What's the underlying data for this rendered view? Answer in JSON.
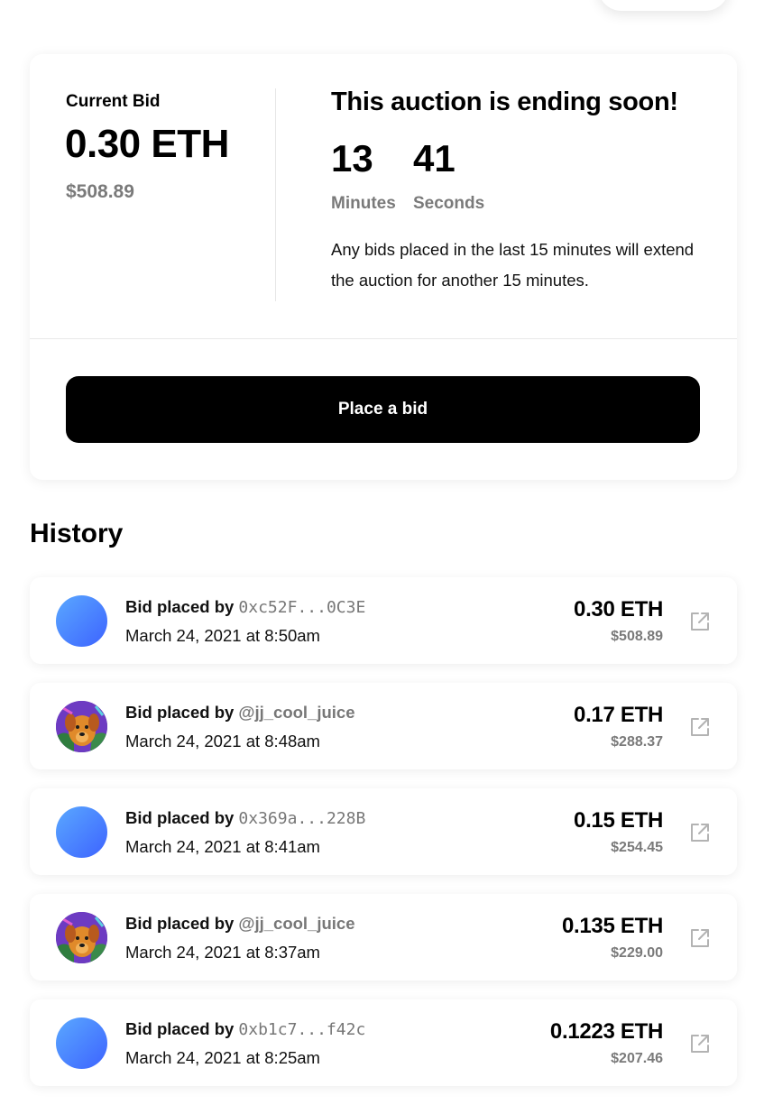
{
  "auction": {
    "current_bid_label": "Current Bid",
    "current_bid_eth": "0.30 ETH",
    "current_bid_usd": "$508.89",
    "ending_title": "This auction is ending soon!",
    "countdown": {
      "minutes_value": "13",
      "minutes_label": "Minutes",
      "seconds_value": "41",
      "seconds_label": "Seconds"
    },
    "notice": "Any bids placed in the last 15 minutes will extend the auction for another 15 minutes.",
    "place_bid_label": "Place a bid"
  },
  "history": {
    "title": "History",
    "bids": [
      {
        "prefix": "Bid placed by",
        "bidder": "0xc52F...0C3E",
        "bidder_type": "address",
        "avatar": "gradient-avatar",
        "date": "March 24, 2021 at 8:50am",
        "eth": "0.30 ETH",
        "usd": "$508.89",
        "icon": "external-link-icon"
      },
      {
        "prefix": "Bid placed by",
        "bidder": "@jj_cool_juice",
        "bidder_type": "handle",
        "avatar": "dog-avatar",
        "date": "March 24, 2021 at 8:48am",
        "eth": "0.17 ETH",
        "usd": "$288.37",
        "icon": "external-link-icon"
      },
      {
        "prefix": "Bid placed by",
        "bidder": "0x369a...228B",
        "bidder_type": "address",
        "avatar": "gradient-avatar",
        "date": "March 24, 2021 at 8:41am",
        "eth": "0.15 ETH",
        "usd": "$254.45",
        "icon": "external-link-icon"
      },
      {
        "prefix": "Bid placed by",
        "bidder": "@jj_cool_juice",
        "bidder_type": "handle",
        "avatar": "dog-avatar",
        "date": "March 24, 2021 at 8:37am",
        "eth": "0.135 ETH",
        "usd": "$229.00",
        "icon": "external-link-icon"
      },
      {
        "prefix": "Bid placed by",
        "bidder": "0xb1c7...f42c",
        "bidder_type": "address",
        "avatar": "gradient-avatar",
        "date": "March 24, 2021 at 8:25am",
        "eth": "0.1223 ETH",
        "usd": "$207.46",
        "icon": "external-link-icon"
      }
    ]
  },
  "colors": {
    "primary": "#000000",
    "muted_text": "#7a7a7a",
    "avatar_gradient_start": "#5aa8ff",
    "avatar_gradient_end": "#3d63ff",
    "background": "#ffffff"
  }
}
